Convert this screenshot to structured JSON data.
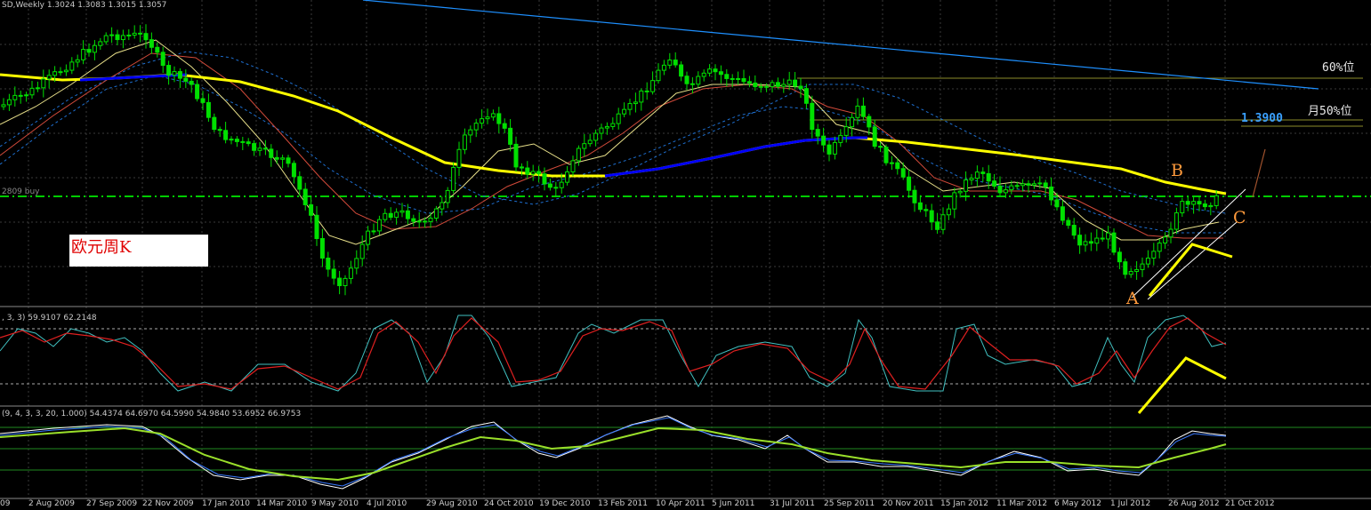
{
  "header": {
    "main_info": "SD,Weekly  1.3024 1.3083 1.3015 1.3057",
    "stoch_info": ", 3, 3) 59.9107 62.2148",
    "osc2_info": "(9, 4, 3, 3, 20, 1.000) 54.4374 64.6970 64.5990 54.9840 53.6952 66.9753",
    "price_line_label": "2809 buy"
  },
  "annotations": {
    "title": "欧元周K",
    "level_60": "60%位",
    "level_50": "月50%位",
    "price_level": "1.3900",
    "wave_a": "A",
    "wave_b": "B",
    "wave_c": "C"
  },
  "time_axis": {
    "labels": [
      "09",
      "2 Aug 2009",
      "27 Sep 2009",
      "22 Nov 2009",
      "17 Jan 2010",
      "14 Mar 2010",
      "9 May 2010",
      "4 Jul 2010",
      "29 Aug 2010",
      "24 Oct 2010",
      "19 Dec 2010",
      "13 Feb 2011",
      "10 Apr 2011",
      "5 Jun 2011",
      "31 Jul 2011",
      "25 Sep 2011",
      "20 Nov 2011",
      "15 Jan 2012",
      "11 Mar 2012",
      "6 May 2012",
      "1 Jul 2012",
      "26 Aug 2012",
      "21 Oct 2012"
    ]
  },
  "colors": {
    "background": "#000000",
    "bull_candle": "#00ff00",
    "bear_candle": "#00dd00",
    "ma_fast": "#ffff00",
    "ma_blue": "#0000ff",
    "trend_line": "#1e90ff",
    "annotation_yellow": "#ffff00"
  }
}
